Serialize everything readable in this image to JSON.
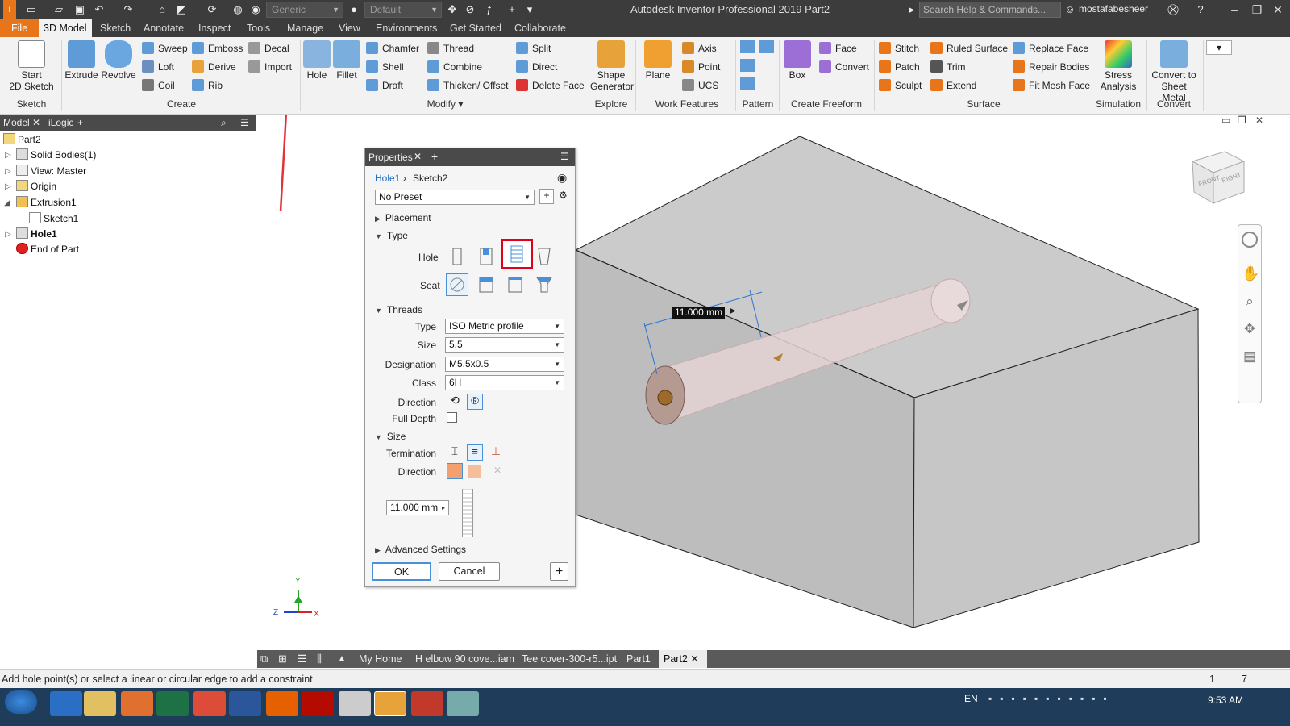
{
  "titlebar": {
    "appearance_combo": "Generic",
    "material_combo": "Default",
    "app_title": "Autodesk Inventor Professional 2019    Part2",
    "search_placeholder": "Search Help & Commands...",
    "user": "mostafabesheer"
  },
  "menu": {
    "tabs": [
      "File",
      "3D Model",
      "Sketch",
      "Annotate",
      "Inspect",
      "Tools",
      "Manage",
      "View",
      "Environments",
      "Get Started",
      "Collaborate"
    ]
  },
  "ribbon": {
    "sketch": {
      "start": "Start",
      "start2": "2D Sketch",
      "group": "Sketch"
    },
    "create": {
      "extrude": "Extrude",
      "revolve": "Revolve",
      "sweep": "Sweep",
      "loft": "Loft",
      "coil": "Coil",
      "emboss": "Emboss",
      "derive": "Derive",
      "rib": "Rib",
      "decal": "Decal",
      "import": "Import",
      "group": "Create"
    },
    "modify": {
      "hole": "Hole",
      "fillet": "Fillet",
      "chamfer": "Chamfer",
      "shell": "Shell",
      "draft": "Draft",
      "thread": "Thread",
      "combine": "Combine",
      "thicken": "Thicken/ Offset",
      "split": "Split",
      "direct": "Direct",
      "delete_face": "Delete Face",
      "group": "Modify ▾"
    },
    "explore": {
      "shape": "Shape",
      "generator": "Generator",
      "group": "Explore"
    },
    "work": {
      "plane": "Plane",
      "axis": "Axis",
      "point": "Point",
      "ucs": "UCS",
      "group": "Work Features"
    },
    "pattern": {
      "group": "Pattern"
    },
    "freeform": {
      "box": "Box",
      "face": "Face",
      "convert": "Convert",
      "group": "Create Freeform"
    },
    "surface": {
      "stitch": "Stitch",
      "patch": "Patch",
      "sculpt": "Sculpt",
      "ruled": "Ruled Surface",
      "trim": "Trim",
      "extend": "Extend",
      "replace": "Replace Face",
      "repair": "Repair Bodies",
      "fitmesh": "Fit Mesh Face",
      "group": "Surface"
    },
    "simulation": {
      "stress": "Stress",
      "analysis": "Analysis",
      "group": "Simulation"
    },
    "convert": {
      "c1": "Convert to",
      "c2": "Sheet Metal",
      "group": "Convert"
    }
  },
  "browser": {
    "tab_model": "Model",
    "tab_ilogic": "iLogic",
    "items": [
      "Part2",
      "Solid Bodies(1)",
      "View: Master",
      "Origin",
      "Extrusion1",
      "Sketch1",
      "Hole1",
      "End of Part"
    ]
  },
  "properties": {
    "tab": "Properties",
    "crumb_link": "Hole1",
    "crumb_current": "Sketch2",
    "preset": "No Preset",
    "placement": "Placement",
    "type": "Type",
    "hole_label": "Hole",
    "seat_label": "Seat",
    "threads": "Threads",
    "thread_type_label": "Type",
    "thread_type": "ISO Metric profile",
    "size_label": "Size",
    "size": "5.5",
    "designation_label": "Designation",
    "designation": "M5.5x0.5",
    "class_label": "Class",
    "class": "6H",
    "direction_label": "Direction",
    "full_depth": "Full Depth",
    "size_section": "Size",
    "termination_label": "Termination",
    "direction2_label": "Direction",
    "depth_value": "11.000 mm",
    "advanced": "Advanced Settings",
    "ok": "OK",
    "cancel": "Cancel"
  },
  "viewport": {
    "dimension": "11.000 mm",
    "viewcube_front": "FRONT",
    "viewcube_right": "RIGHT",
    "axis_y": "Y",
    "axis_z": "Z",
    "axis_x": "X"
  },
  "doctabs": [
    "My Home",
    "H elbow 90 cove...iam",
    "Tee cover-300-r5...ipt",
    "Part1",
    "Part2"
  ],
  "status": {
    "message": "Add hole point(s) or select a linear or circular edge to add a constraint",
    "n1": "1",
    "n2": "7"
  },
  "taskbar": {
    "lang": "EN",
    "time": "9:53 AM"
  },
  "colors": {
    "accent": "#e8751a",
    "highlight": "#e0001b",
    "link": "#1a6fc4"
  }
}
